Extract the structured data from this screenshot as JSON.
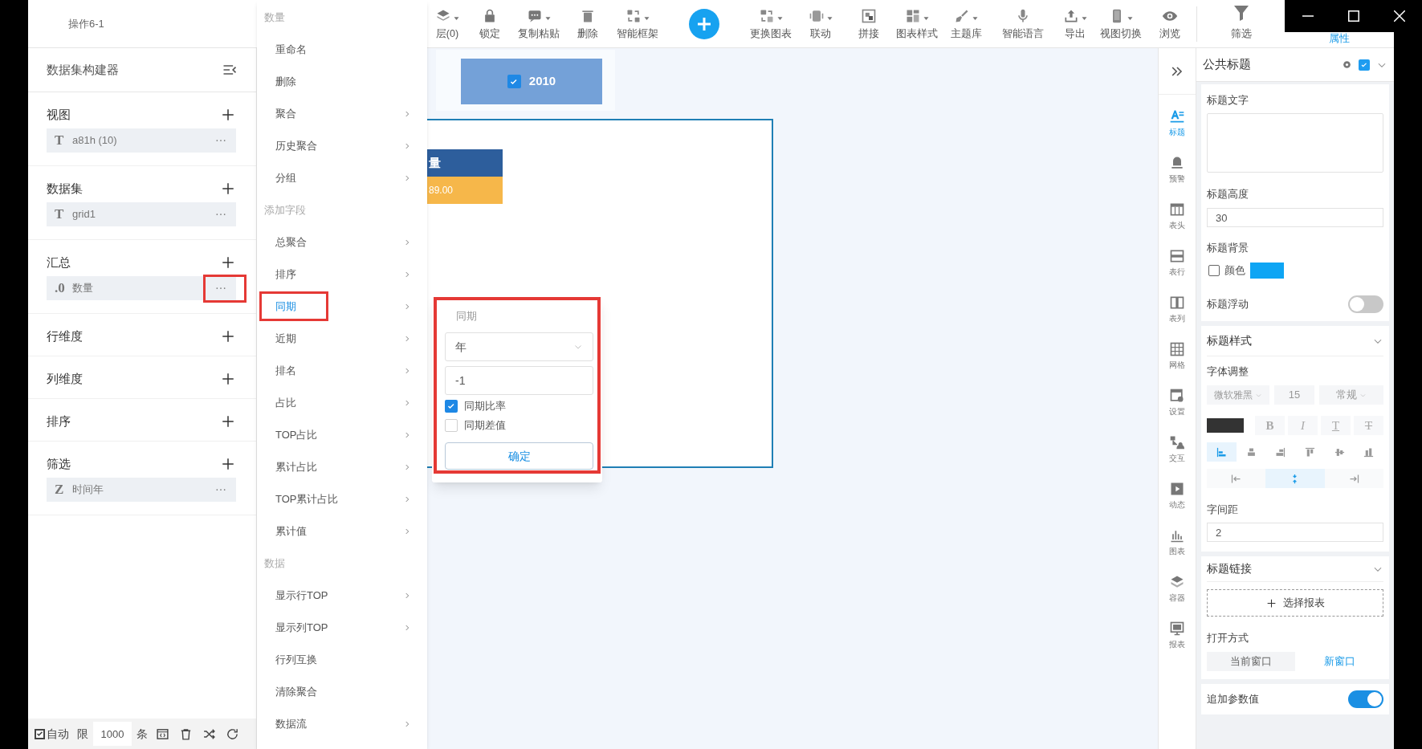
{
  "window": {
    "title": "操作6-1"
  },
  "toolbar": [
    {
      "kind": "tool",
      "label": "层(0)",
      "dropdown": true
    },
    {
      "kind": "tool",
      "label": "锁定",
      "dropdown": false
    },
    {
      "kind": "tool",
      "label": "复制粘贴",
      "dropdown": true
    },
    {
      "kind": "tool",
      "label": "删除",
      "dropdown": false
    },
    {
      "kind": "tool",
      "label": "智能框架",
      "dropdown": true
    },
    {
      "kind": "add"
    },
    {
      "kind": "tool",
      "label": "更换图表",
      "dropdown": true
    },
    {
      "kind": "tool",
      "label": "联动",
      "dropdown": true
    },
    {
      "kind": "tool",
      "label": "拼接",
      "dropdown": false
    },
    {
      "kind": "tool",
      "label": "图表样式",
      "dropdown": true
    },
    {
      "kind": "tool",
      "label": "主题库",
      "dropdown": true
    },
    {
      "kind": "tool",
      "label": "智能语言",
      "dropdown": false
    },
    {
      "kind": "tool",
      "label": "导出",
      "dropdown": true
    },
    {
      "kind": "tool",
      "label": "视图切换",
      "dropdown": true
    },
    {
      "kind": "tool",
      "label": "浏览",
      "dropdown": false
    }
  ],
  "panel_tabs": [
    {
      "label": "筛选",
      "selected": false
    },
    {
      "label": "属性",
      "selected": true
    }
  ],
  "builder": {
    "title": "数据集构建器",
    "sections": [
      {
        "title": "视图",
        "fields": [
          {
            "type": "T",
            "name": "a81h (10)",
            "highlighted": false
          }
        ]
      },
      {
        "title": "数据集",
        "fields": [
          {
            "type": "T",
            "name": "grid1",
            "highlighted": false
          }
        ]
      },
      {
        "title": "汇总",
        "fields": [
          {
            "type": ".0",
            "name": "数量",
            "highlighted": true
          }
        ]
      },
      {
        "title": "行维度"
      },
      {
        "title": "列维度"
      },
      {
        "title": "排序"
      },
      {
        "title": "筛选",
        "fields": [
          {
            "type": "Z",
            "name": "时间年",
            "highlighted": false
          }
        ]
      }
    ],
    "footer": {
      "auto": {
        "label": "自动",
        "checked": true
      },
      "limit_label": "限",
      "limit": "1000",
      "unit": "条"
    }
  },
  "menu": {
    "items": [
      {
        "kind": "header",
        "label": "数量"
      },
      {
        "kind": "item",
        "label": "重命名",
        "submenu": false,
        "selected": false
      },
      {
        "kind": "item",
        "label": "删除",
        "submenu": false,
        "selected": false
      },
      {
        "kind": "item",
        "label": "聚合",
        "submenu": true,
        "selected": false
      },
      {
        "kind": "item",
        "label": "历史聚合",
        "submenu": true,
        "selected": false
      },
      {
        "kind": "item",
        "label": "分组",
        "submenu": true,
        "selected": false
      },
      {
        "kind": "header",
        "label": "添加字段"
      },
      {
        "kind": "item",
        "label": "总聚合",
        "submenu": true,
        "selected": false
      },
      {
        "kind": "item",
        "label": "排序",
        "submenu": true,
        "selected": false
      },
      {
        "kind": "item",
        "label": "同期",
        "submenu": true,
        "selected": true
      },
      {
        "kind": "item",
        "label": "近期",
        "submenu": true,
        "selected": false
      },
      {
        "kind": "item",
        "label": "排名",
        "submenu": true,
        "selected": false
      },
      {
        "kind": "item",
        "label": "占比",
        "submenu": true,
        "selected": false
      },
      {
        "kind": "item",
        "label": "TOP占比",
        "submenu": true,
        "selected": false
      },
      {
        "kind": "item",
        "label": "累计占比",
        "submenu": true,
        "selected": false
      },
      {
        "kind": "item",
        "label": "TOP累计占比",
        "submenu": true,
        "selected": false
      },
      {
        "kind": "item",
        "label": "累计值",
        "submenu": true,
        "selected": false
      },
      {
        "kind": "header",
        "label": "数据"
      },
      {
        "kind": "item",
        "label": "显示行TOP",
        "submenu": true,
        "selected": false
      },
      {
        "kind": "item",
        "label": "显示列TOP",
        "submenu": true,
        "selected": false
      },
      {
        "kind": "item",
        "label": "行列互换",
        "submenu": false,
        "selected": false
      },
      {
        "kind": "item",
        "label": "清除聚合",
        "submenu": false,
        "selected": false
      },
      {
        "kind": "item",
        "label": "数据流",
        "submenu": true,
        "selected": false
      }
    ]
  },
  "canvas": {
    "filter": {
      "label": "2010",
      "checked": true
    },
    "table": {
      "header": "量",
      "value": "89.00"
    },
    "popup": {
      "title": "同期",
      "period": "年",
      "number": "-1",
      "highlighted": true,
      "options": [
        {
          "label": "同期比率",
          "checked": true
        },
        {
          "label": "同期差值",
          "checked": false
        }
      ],
      "confirm": "确定"
    }
  },
  "side_tabs": [
    {
      "label": "标题",
      "selected": true
    },
    {
      "label": "预警",
      "selected": false
    },
    {
      "label": "表头",
      "selected": false
    },
    {
      "label": "表行",
      "selected": false
    },
    {
      "label": "表列",
      "selected": false
    },
    {
      "label": "网格",
      "selected": false
    },
    {
      "label": "设置",
      "selected": false
    },
    {
      "label": "交互",
      "selected": false
    },
    {
      "label": "动态",
      "selected": false
    },
    {
      "label": "图表",
      "selected": false
    },
    {
      "label": "容器",
      "selected": false
    },
    {
      "label": "报表",
      "selected": false
    }
  ],
  "properties": {
    "title": "公共标题",
    "enabled": true,
    "title_text": {
      "label": "标题文字"
    },
    "title_height": {
      "label": "标题高度",
      "value": "30"
    },
    "title_background": {
      "label": "标题背景",
      "option": "颜色",
      "checked": false,
      "color": "#0ea5f4"
    },
    "title_float": {
      "label": "标题浮动",
      "on": false
    },
    "style": {
      "title": "标题样式",
      "font_label": "字体调整",
      "font": "微软雅黑",
      "size": "15",
      "weight": "常规",
      "color": "#333333",
      "format": [
        {
          "kind": "bold",
          "label": "B"
        },
        {
          "kind": "italic",
          "label": "I"
        },
        {
          "kind": "underline",
          "label": "T"
        },
        {
          "kind": "strike",
          "label": "T"
        }
      ],
      "align": [
        {
          "selected": true
        },
        {
          "selected": false
        },
        {
          "selected": false
        },
        {
          "selected": false
        },
        {
          "selected": false
        },
        {
          "selected": false
        }
      ],
      "spacing_modes": [
        {
          "selected": false
        },
        {
          "selected": true
        },
        {
          "selected": false
        }
      ],
      "spacing_label": "字间距",
      "spacing": "2"
    },
    "link": {
      "title": "标题链接",
      "add_label": "选择报表",
      "open_label": "打开方式",
      "open_modes": [
        {
          "label": "当前窗口",
          "selected": false
        },
        {
          "label": "新窗口",
          "selected": true
        }
      ],
      "append_label": "追加参数值",
      "append_on": true
    }
  }
}
